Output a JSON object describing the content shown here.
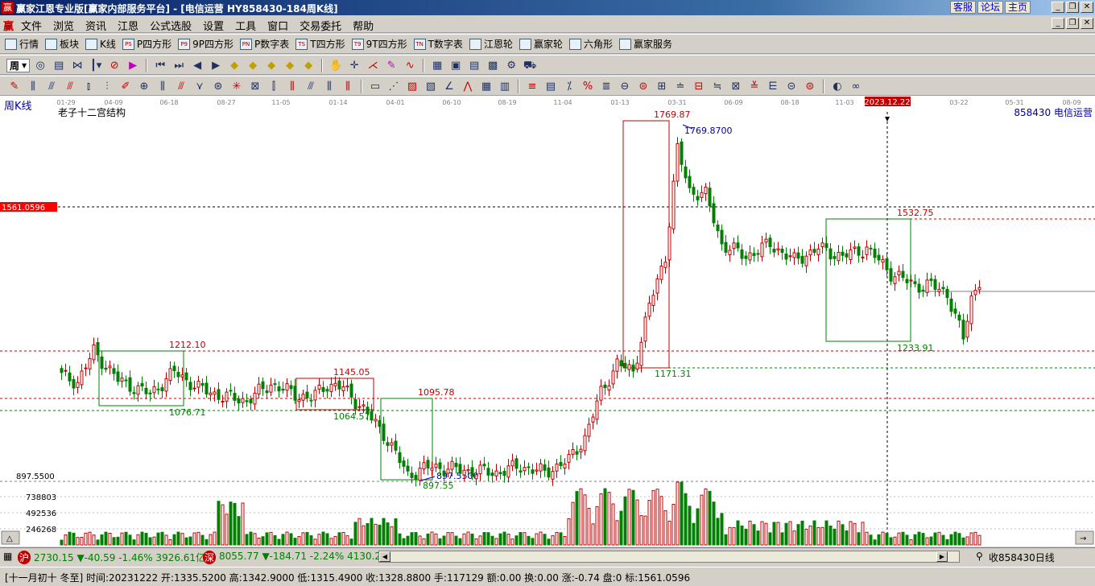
{
  "window": {
    "title": "赢家江恩专业版[赢家内部服务平台] - [电信运营  HY858430-184周K线]",
    "links": [
      "客服",
      "论坛",
      "主页"
    ]
  },
  "menu": {
    "logo": "赢",
    "items": [
      "文件",
      "浏览",
      "资讯",
      "江恩",
      "公式选股",
      "设置",
      "工具",
      "窗口",
      "交易委托",
      "帮助"
    ]
  },
  "toolbar1": [
    {
      "label": "行情",
      "icon": "grid-icon"
    },
    {
      "label": "板块",
      "icon": "blocks-icon"
    },
    {
      "label": "K线",
      "icon": "candle-icon"
    },
    {
      "label": "P四方形",
      "icon": "ps-icon",
      "abbr": "PS"
    },
    {
      "label": "9P四方形",
      "icon": "p9-icon",
      "abbr": "P9"
    },
    {
      "label": "P数字表",
      "icon": "pn-icon",
      "abbr": "PN"
    },
    {
      "label": "T四方形",
      "icon": "ts-icon",
      "abbr": "TS"
    },
    {
      "label": "9T四方形",
      "icon": "t9-icon",
      "abbr": "T9"
    },
    {
      "label": "T数字表",
      "icon": "tn-icon",
      "abbr": "TN"
    },
    {
      "label": "江恩轮",
      "icon": "wheel-icon"
    },
    {
      "label": "赢家轮",
      "icon": "wheel2-icon"
    },
    {
      "label": "六角形",
      "icon": "hexagon-icon"
    },
    {
      "label": "赢家服务",
      "icon": "dollar-icon"
    }
  ],
  "toolbar2": {
    "period": "周"
  },
  "chart": {
    "period_label": "周K线",
    "structure_label": "老子十二宫结构",
    "right_label": "858430 电信运营",
    "date_axis": [
      "01-29",
      "04-09",
      "06-18",
      "08-27",
      "11-05",
      "01-14",
      "04-01",
      "06-10",
      "08-19",
      "11-04",
      "01-13",
      "03-31",
      "06-09",
      "08-18",
      "11-03",
      "2023.12.22",
      "03-22",
      "05-31",
      "08-09"
    ],
    "cursor_price": "1561.0596",
    "left_low_price": "897.5500",
    "volume_ticks": [
      "738803",
      "492536",
      "246268"
    ],
    "annotations": {
      "high": "1769.87",
      "high_full": "1769.8700",
      "a1212": "1212.10",
      "a1145": "1145.05",
      "a1095": "1095.78",
      "a1076": "1076.71",
      "a1064": "1064.57",
      "low": "897.55",
      "low_full": "897.5500",
      "a1171": "1171.31",
      "a1532": "1532.75",
      "a1233": "1233.91"
    }
  },
  "chart_data": {
    "type": "candlestick",
    "title": "电信运营 周K线",
    "series_key_prices": [
      1212.1,
      1145.05,
      1095.78,
      1076.71,
      1064.57,
      897.55,
      1769.87,
      1532.75,
      1233.91,
      1171.31
    ],
    "ylim": [
      897.55,
      1769.87
    ],
    "volume_ticks": [
      738803,
      492536,
      246268
    ]
  },
  "index_bar": {
    "sh_badge": "沪",
    "sh": "2730.15 ▼-40.59 -1.46% 3926.61亿",
    "sz_badge": "深",
    "sz": "8055.77 ▼-184.71 -2.24% 4130.2",
    "right": "收858430日线"
  },
  "status": "[十一月初十 冬至] 时间:20231222 开:1335.5200 高:1342.9000 低:1315.4900 收:1328.8800 手:117129 额:0.00 换:0.00 涨:-0.74 盘:0 标:1561.0596"
}
